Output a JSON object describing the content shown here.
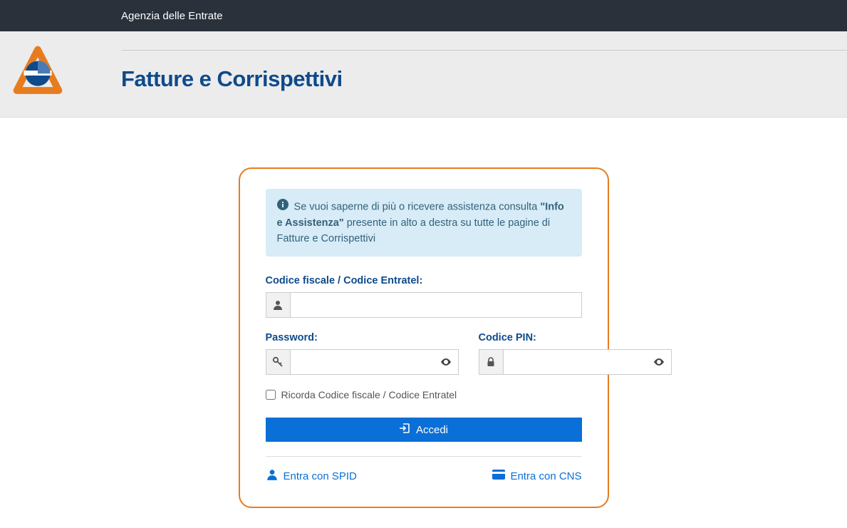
{
  "topbar": {
    "brand": "Agenzia delle Entrate"
  },
  "header": {
    "title": "Fatture e Corrispettivi"
  },
  "info": {
    "prefix": "Se vuoi saperne di più o ricevere assistenza consulta ",
    "strong": "\"Info e Assistenza\"",
    "suffix": " presente in alto a destra su tutte le pagine di Fatture e Corrispettivi"
  },
  "form": {
    "cf_label": "Codice fiscale / Codice Entratel:",
    "cf_value": "",
    "password_label": "Password:",
    "password_value": "",
    "pin_label": "Codice PIN:",
    "pin_value": "",
    "remember_label": "Ricorda Codice fiscale / Codice Entratel",
    "submit_label": "Accedi"
  },
  "alt": {
    "spid_label": "Entra con SPID",
    "cns_label": "Entra con CNS"
  }
}
